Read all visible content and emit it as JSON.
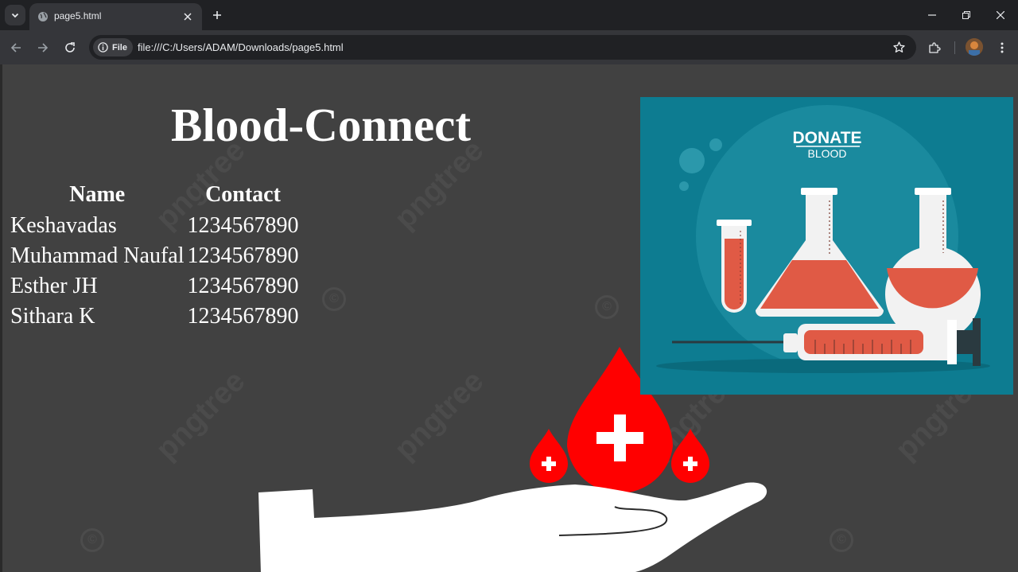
{
  "browser": {
    "tab_title": "page5.html",
    "chip_label": "File",
    "url": "file:///C:/Users/ADAM/Downloads/page5.html"
  },
  "page": {
    "title": "Blood-Connect",
    "table": {
      "headers": [
        "Name",
        "Contact"
      ],
      "rows": [
        [
          "Keshavadas",
          "1234567890"
        ],
        [
          "Muhammad Naufal",
          "1234567890"
        ],
        [
          "Esther JH",
          "1234567890"
        ],
        [
          "Sithara K",
          "1234567890"
        ]
      ]
    },
    "poster": {
      "heading": "DONATE",
      "subheading": "BLOOD"
    },
    "watermark": "pngtree"
  },
  "colors": {
    "page_background": "#414141",
    "poster_background": "#0d7c91",
    "blood_red": "#ff0000",
    "liquid": "#e05a45"
  }
}
